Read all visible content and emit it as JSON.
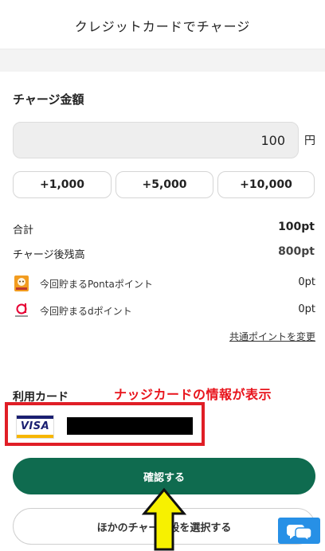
{
  "header": {
    "title": "クレジットカードでチャージ"
  },
  "charge": {
    "title": "チャージ金額",
    "amount": "100",
    "unit": "円",
    "quick_buttons": [
      "+1,000",
      "+5,000",
      "+10,000"
    ]
  },
  "summary": {
    "total_label": "合計",
    "total_value": "100pt",
    "balance_label": "チャージ後残高",
    "balance_value": "800pt"
  },
  "points": {
    "ponta": {
      "label": "今回貯まるPontaポイント",
      "value": "0pt",
      "icon": "ponta-icon"
    },
    "d": {
      "label": "今回貯まるdポイント",
      "value": "0pt",
      "icon": "d-point-icon"
    },
    "change_link": "共通ポイントを変更"
  },
  "card": {
    "label": "利用カード",
    "annotation": "ナッジカードの情報が表示",
    "brand": "VISA"
  },
  "buttons": {
    "confirm": "確認する",
    "other": "ほかのチャー　段を選択する"
  },
  "colors": {
    "brand_green": "#0f6b4f",
    "annotation_red": "#e8141c",
    "arrow_yellow": "#f7f100",
    "chat_blue": "#2790e6"
  }
}
